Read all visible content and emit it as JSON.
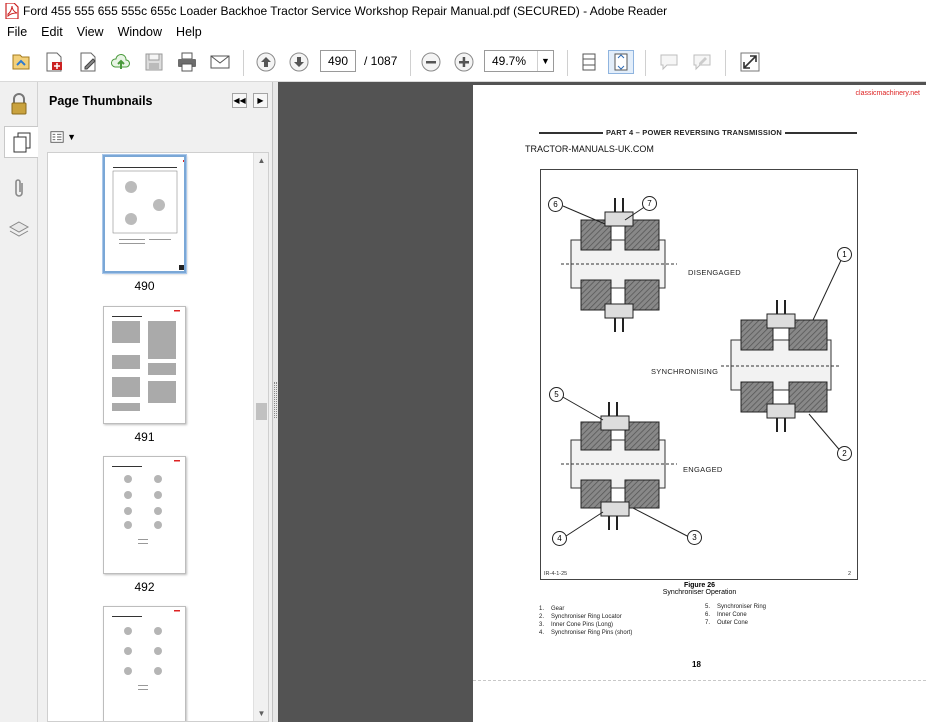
{
  "window": {
    "title": "Ford 455 555 655 555c 655c Loader Backhoe Tractor Service  Workshop  Repair Manual.pdf (SECURED) - Adobe Reader"
  },
  "menu": [
    "File",
    "Edit",
    "View",
    "Window",
    "Help"
  ],
  "toolbar": {
    "current_page": "490",
    "total_pages": "/  1087",
    "zoom": "49.7%"
  },
  "sidebar": {
    "title": "Page Thumbnails",
    "thumbnails": [
      {
        "page": "490",
        "selected": true
      },
      {
        "page": "491",
        "selected": false
      },
      {
        "page": "492",
        "selected": false
      },
      {
        "page": "",
        "selected": false
      }
    ]
  },
  "document": {
    "watermark": "classicmachinery.net",
    "part_title": "PART 4 – POWER REVERSING TRANSMISSION",
    "site": "TRACTOR-MANUALS-UK.COM",
    "figure_labels": {
      "disengaged": "DISENGAGED",
      "synchronising": "SYNCHRONISING",
      "engaged": "ENGAGED"
    },
    "callouts": [
      "1",
      "2",
      "3",
      "4",
      "5",
      "6",
      "7"
    ],
    "figure_id": "IR-4-1-25",
    "figure_corner": "2",
    "figure_number": "Figure 26",
    "figure_title": "Synchroniser Operation",
    "legend_left": [
      {
        "n": "1.",
        "text": "Gear"
      },
      {
        "n": "2.",
        "text": "Synchroniser Ring Locator"
      },
      {
        "n": "3.",
        "text": "Inner Cone Pins (Long)"
      },
      {
        "n": "4.",
        "text": "Synchroniser Ring Pins (short)"
      }
    ],
    "legend_right": [
      {
        "n": "5.",
        "text": "Synchroniser Ring"
      },
      {
        "n": "6.",
        "text": "Inner Cone"
      },
      {
        "n": "7.",
        "text": "Outer Cone"
      }
    ],
    "page_number": "18"
  }
}
